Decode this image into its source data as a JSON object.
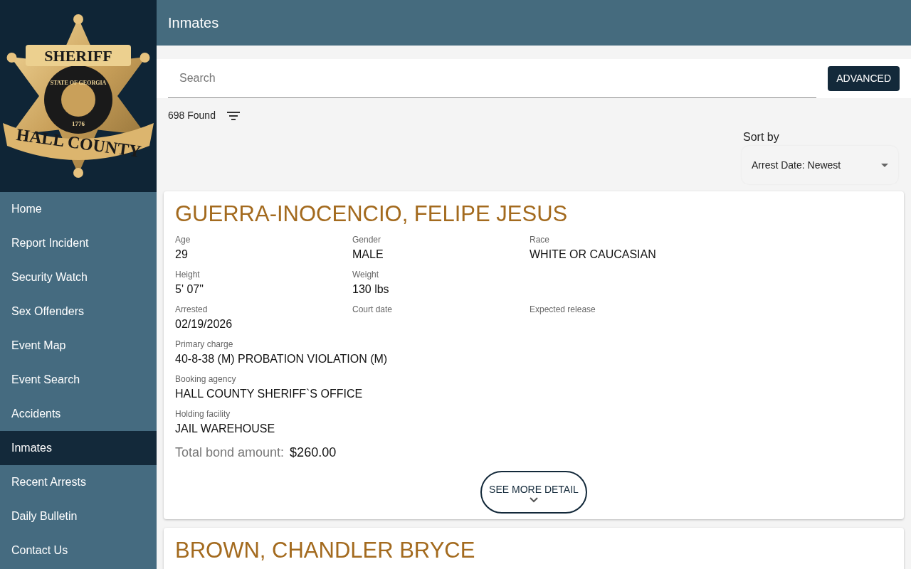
{
  "logo": {
    "top_text": "SHERIFF",
    "ring_text": "STATE OF GEORGIA",
    "year": "1776",
    "bottom_text": "HALL COUNTY"
  },
  "sidebar": {
    "items": [
      {
        "label": "Home",
        "selected": false
      },
      {
        "label": "Report Incident",
        "selected": false
      },
      {
        "label": "Security Watch",
        "selected": false
      },
      {
        "label": "Sex Offenders",
        "selected": false
      },
      {
        "label": "Event Map",
        "selected": false
      },
      {
        "label": "Event Search",
        "selected": false
      },
      {
        "label": "Accidents",
        "selected": false
      },
      {
        "label": "Inmates",
        "selected": true
      },
      {
        "label": "Recent Arrests",
        "selected": false
      },
      {
        "label": "Daily Bulletin",
        "selected": false
      },
      {
        "label": "Contact Us",
        "selected": false
      }
    ]
  },
  "header": {
    "title": "Inmates"
  },
  "search": {
    "placeholder": "Search",
    "button": "ADVANCED"
  },
  "results": {
    "count": "698 Found"
  },
  "sort": {
    "label": "Sort by",
    "value": "Arrest Date: Newest"
  },
  "inmates": [
    {
      "name": "GUERRA-INOCENCIO, FELIPE JESUS",
      "rows": [
        [
          {
            "label": "Age",
            "value": "29"
          },
          {
            "label": "Gender",
            "value": "MALE"
          },
          {
            "label": "Race",
            "value": "WHITE OR CAUCASIAN"
          }
        ],
        [
          {
            "label": "Height",
            "value": "5' 07\""
          },
          {
            "label": "Weight",
            "value": "130 lbs"
          }
        ],
        [
          {
            "label": "Arrested",
            "value": "02/19/2026"
          },
          {
            "label": "Court date"
          },
          {
            "label": "Expected release"
          }
        ],
        [
          {
            "label": "Primary charge",
            "value": "40-8-38 (M) PROBATION VIOLATION (M)"
          }
        ],
        [
          {
            "label": "Booking agency",
            "value": "HALL COUNTY SHERIFF`S OFFICE"
          }
        ],
        [
          {
            "label": "Holding facility",
            "value": "JAIL WAREHOUSE"
          }
        ]
      ],
      "bond_label": "Total bond amount:",
      "bond": "$260.00",
      "detail_button": "SEE MORE DETAIL"
    },
    {
      "name": "BROWN, CHANDLER BRYCE"
    }
  ]
}
